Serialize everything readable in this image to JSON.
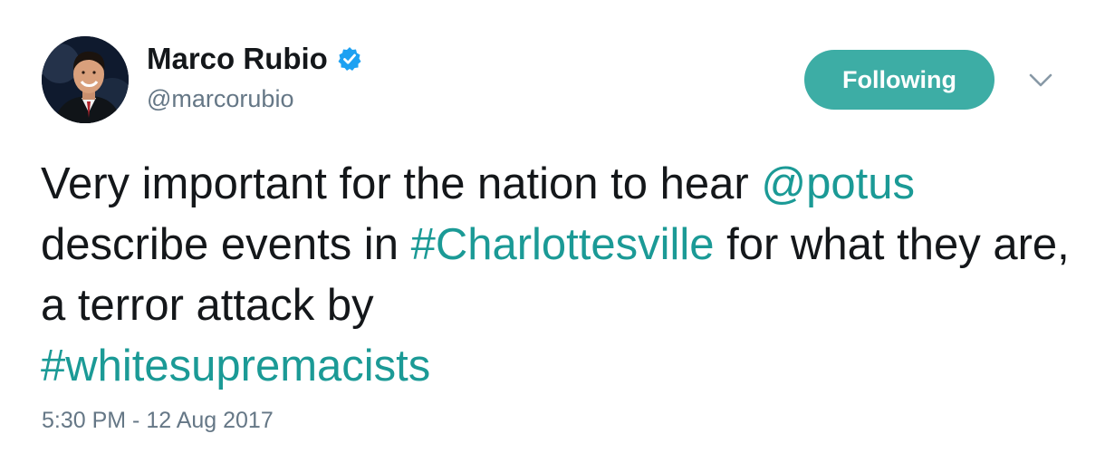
{
  "author": {
    "name": "Marco Rubio",
    "handle": "@marcorubio",
    "verified": true
  },
  "follow_button": {
    "label": "Following"
  },
  "tweet": {
    "segments": [
      {
        "text": "Very important for the nation to hear ",
        "link": false
      },
      {
        "text": "@potus",
        "link": true
      },
      {
        "text": " describe events in ",
        "link": false
      },
      {
        "text": "#Charlottesville",
        "link": true
      },
      {
        "text": " for what they are, a terror attack by ",
        "link": false
      },
      {
        "text": "#whitesupremacists",
        "link": true
      }
    ]
  },
  "timestamp": "5:30 PM - 12 Aug 2017",
  "colors": {
    "link": "#1b9a96",
    "follow_button_bg": "#3dada5",
    "secondary_text": "#657786",
    "verified_badge": "#1da1f2"
  },
  "icons": {
    "verified": "verified-badge-icon",
    "menu": "chevron-down-icon"
  }
}
